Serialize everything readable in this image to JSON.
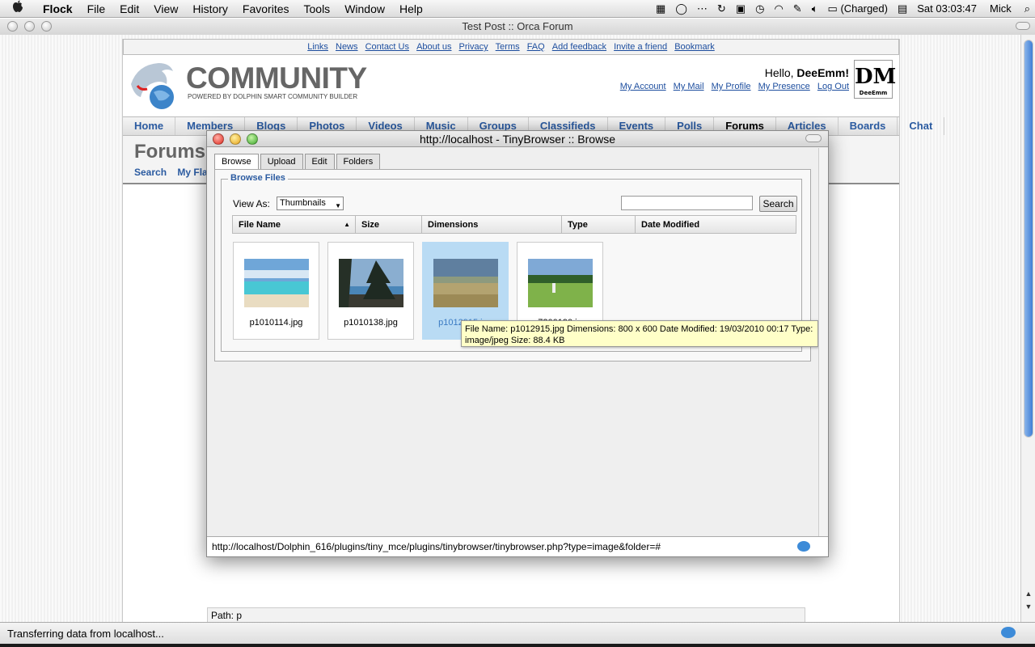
{
  "menubar": {
    "apple": "",
    "items": [
      "Flock",
      "File",
      "Edit",
      "View",
      "History",
      "Favorites",
      "Tools",
      "Window",
      "Help"
    ],
    "battery": "(Charged)",
    "clock": "Sat 03:03:47",
    "user": "Mick"
  },
  "browser": {
    "title": "Test Post :: Orca Forum",
    "status": "Transferring data from localhost..."
  },
  "page": {
    "top_links": [
      "Links",
      "News",
      "Contact Us",
      "About us",
      "Privacy",
      "Terms",
      "FAQ",
      "Add feedback",
      "Invite a friend",
      "Bookmark"
    ],
    "logo_title": "COMMUNITY",
    "logo_sub": "POWERED BY DOLPHIN SMART COMMUNITY BUILDER",
    "hello_prefix": "Hello, ",
    "hello_name": "DeeEmm!",
    "user_links": [
      "My Account",
      "My Mail",
      "My Profile",
      "My Presence",
      "Log Out"
    ],
    "avatar_text": "DM",
    "avatar_sub": "DeeEmm",
    "nav": [
      "Home",
      "Members",
      "Blogs",
      "Photos",
      "Videos",
      "Music",
      "Groups",
      "Classifieds",
      "Events",
      "Polls",
      "Forums",
      "Articles",
      "Boards",
      "Chat"
    ],
    "active_nav": "Forums",
    "page_title": "Forums",
    "sub_links": "Search    My Fla",
    "path": "Path: p"
  },
  "popup": {
    "title": "http://localhost - TinyBrowser :: Browse",
    "tabs": [
      "Browse",
      "Upload",
      "Edit",
      "Folders"
    ],
    "legend": "Browse Files",
    "view_as_label": "View As:",
    "view_as_value": "Thumbnails",
    "search_button": "Search",
    "columns": [
      "File Name",
      "Size",
      "Dimensions",
      "Type",
      "Date Modified"
    ],
    "files": [
      "p1010114.jpg",
      "p1010138.jpg",
      "p1012915.jpg",
      "p7200190.jpg"
    ],
    "tooltip": "File Name: p1012915.jpg Dimensions: 800 x 600 Date Modified: 19/03/2010 00:17 Type: image/jpeg Size: 88.4 KB",
    "url": "http://localhost/Dolphin_616/plugins/tiny_mce/plugins/tinybrowser/tinybrowser.php?type=image&folder=#"
  }
}
